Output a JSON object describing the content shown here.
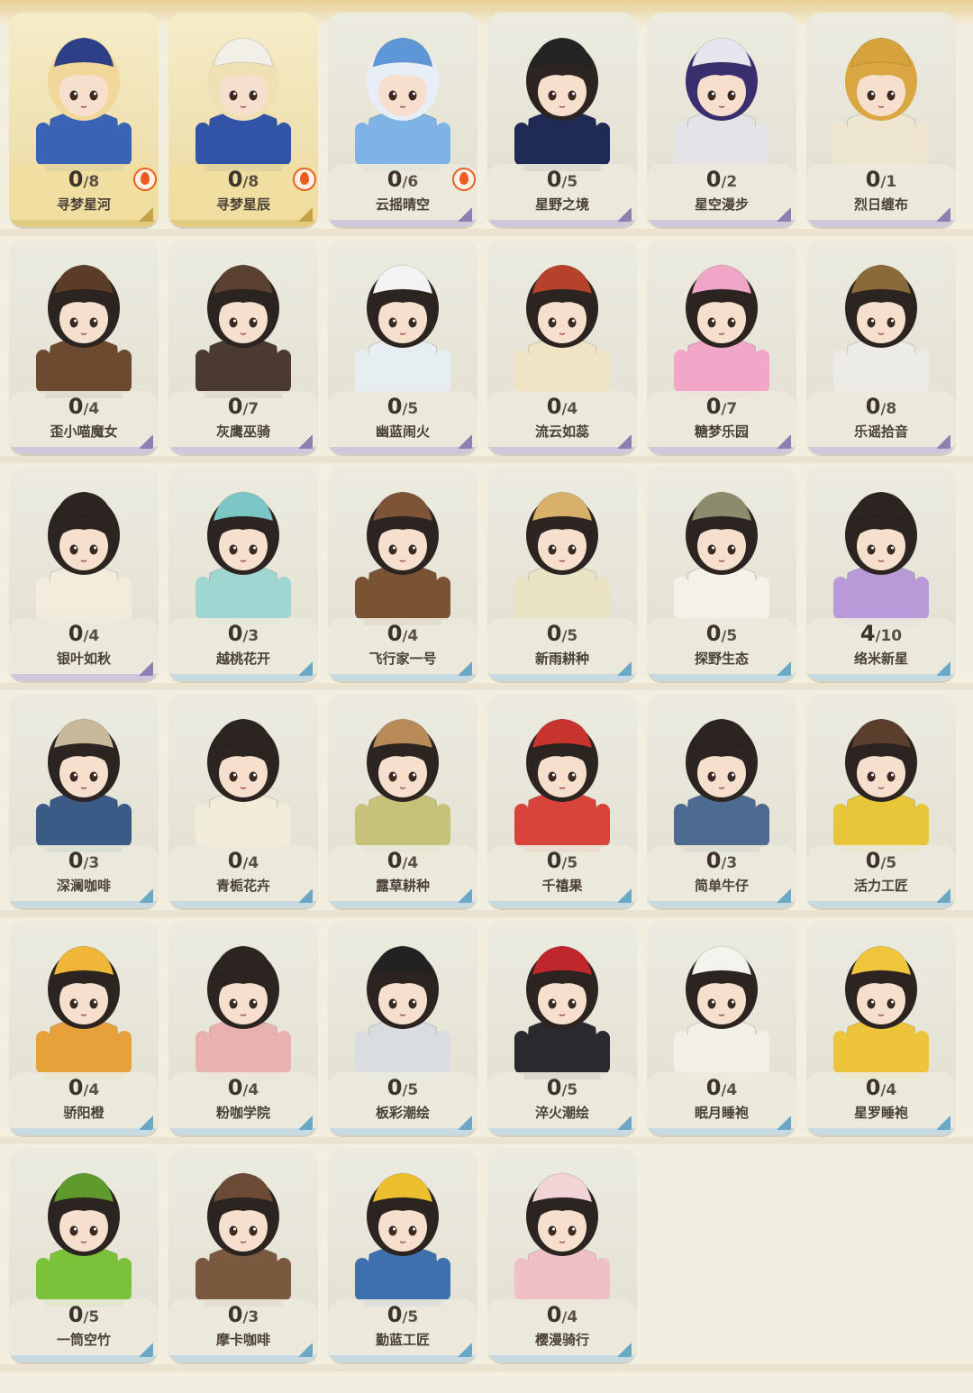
{
  "outfits": [
    {
      "name": "寻梦星河",
      "owned": "0",
      "total": "8",
      "rarity": "gold",
      "flame": true,
      "theme": {
        "hair": "#f1d79a",
        "outfit": "#3b63b5",
        "hat": "#2d3f86"
      }
    },
    {
      "name": "寻梦星辰",
      "owned": "0",
      "total": "8",
      "rarity": "gold",
      "flame": true,
      "theme": {
        "hair": "#efe0b6",
        "outfit": "#3154a6",
        "hat": "#f2efe8"
      }
    },
    {
      "name": "云摇晴空",
      "owned": "0",
      "total": "6",
      "rarity": "purple",
      "flame": true,
      "theme": {
        "hair": "#e8eef8",
        "outfit": "#7fb3e6",
        "hat": "#5d97d8"
      }
    },
    {
      "name": "星野之境",
      "owned": "0",
      "total": "5",
      "rarity": "purple",
      "flame": false,
      "theme": {
        "hair": "#2b2420",
        "outfit": "#1f2a55",
        "hat": "#232323"
      }
    },
    {
      "name": "星空漫步",
      "owned": "0",
      "total": "2",
      "rarity": "purple",
      "flame": false,
      "theme": {
        "hair": "#3a2f6e",
        "outfit": "#e3e3e8",
        "hat": "#e5e6ee"
      }
    },
    {
      "name": "烈日缠布",
      "owned": "0",
      "total": "1",
      "rarity": "purple",
      "flame": false,
      "theme": {
        "hair": "#d9a642",
        "outfit": "#efe6d2",
        "hat": "#d6a23c"
      }
    },
    {
      "name": "歪小喵魔女",
      "owned": "0",
      "total": "4",
      "rarity": "purple",
      "flame": false,
      "theme": {
        "hair": "#2b2420",
        "outfit": "#6b4a2f",
        "hat": "#5b3c26"
      }
    },
    {
      "name": "灰鹰巫骑",
      "owned": "0",
      "total": "7",
      "rarity": "purple",
      "flame": false,
      "theme": {
        "hair": "#2b2420",
        "outfit": "#4a3a30",
        "hat": "#5a4030"
      }
    },
    {
      "name": "幽蓝闹火",
      "owned": "0",
      "total": "5",
      "rarity": "purple",
      "flame": false,
      "theme": {
        "hair": "#2b2420",
        "outfit": "#e6eef2",
        "hat": "#f3f3f3"
      }
    },
    {
      "name": "流云如蕊",
      "owned": "0",
      "total": "4",
      "rarity": "purple",
      "flame": false,
      "theme": {
        "hair": "#2b2420",
        "outfit": "#efe4c4",
        "hat": "#b5432c"
      }
    },
    {
      "name": "糖梦乐园",
      "owned": "0",
      "total": "7",
      "rarity": "purple",
      "flame": false,
      "theme": {
        "hair": "#2b2420",
        "outfit": "#f3a7c8",
        "hat": "#f0a6c6"
      }
    },
    {
      "name": "乐谣拾音",
      "owned": "0",
      "total": "8",
      "rarity": "purple",
      "flame": false,
      "theme": {
        "hair": "#2b2420",
        "outfit": "#ecebe6",
        "hat": "#8a6a3a"
      }
    },
    {
      "name": "银叶如秋",
      "owned": "0",
      "total": "4",
      "rarity": "purple",
      "flame": false,
      "theme": {
        "hair": "#2b2420",
        "outfit": "#f3ecdc",
        "hat": "#2b2420"
      }
    },
    {
      "name": "越桃花开",
      "owned": "0",
      "total": "3",
      "rarity": "blue",
      "flame": false,
      "theme": {
        "hair": "#2b2420",
        "outfit": "#9fd6d2",
        "hat": "#7cc6c6"
      }
    },
    {
      "name": "飞行家一号",
      "owned": "0",
      "total": "4",
      "rarity": "blue",
      "flame": false,
      "theme": {
        "hair": "#2b2420",
        "outfit": "#7a5234",
        "hat": "#7e5436"
      }
    },
    {
      "name": "新雨耕种",
      "owned": "0",
      "total": "5",
      "rarity": "blue",
      "flame": false,
      "theme": {
        "hair": "#2b2420",
        "outfit": "#e9e3c3",
        "hat": "#d8b06a"
      }
    },
    {
      "name": "探野生态",
      "owned": "0",
      "total": "5",
      "rarity": "blue",
      "flame": false,
      "theme": {
        "hair": "#2b2420",
        "outfit": "#f3f1ea",
        "hat": "#8c8b6c"
      }
    },
    {
      "name": "络米新星",
      "owned": "4",
      "total": "10",
      "rarity": "blue",
      "flame": false,
      "theme": {
        "hair": "#2b2420",
        "outfit": "#b99ad8",
        "hat": "#2b2420"
      }
    },
    {
      "name": "深澜咖啡",
      "owned": "0",
      "total": "3",
      "rarity": "blue",
      "flame": false,
      "theme": {
        "hair": "#2b2420",
        "outfit": "#3b5a86",
        "hat": "#c9b89a"
      }
    },
    {
      "name": "青栀花卉",
      "owned": "0",
      "total": "4",
      "rarity": "blue",
      "flame": false,
      "theme": {
        "hair": "#2b2420",
        "outfit": "#f1ecd9",
        "hat": "#2b2420"
      }
    },
    {
      "name": "露草耕种",
      "owned": "0",
      "total": "4",
      "rarity": "blue",
      "flame": false,
      "theme": {
        "hair": "#2b2420",
        "outfit": "#c7c27a",
        "hat": "#b88a58"
      }
    },
    {
      "name": "千禧果",
      "owned": "0",
      "total": "5",
      "rarity": "blue",
      "flame": false,
      "theme": {
        "hair": "#2b2420",
        "outfit": "#d8433a",
        "hat": "#c9342e"
      }
    },
    {
      "name": "简单牛仔",
      "owned": "0",
      "total": "3",
      "rarity": "blue",
      "flame": false,
      "theme": {
        "hair": "#2b2420",
        "outfit": "#4d6a90",
        "hat": "#2b2420"
      }
    },
    {
      "name": "活力工匠",
      "owned": "0",
      "total": "5",
      "rarity": "blue",
      "flame": false,
      "theme": {
        "hair": "#2b2420",
        "outfit": "#e8c63a",
        "hat": "#5b3f2c"
      }
    },
    {
      "name": "骄阳橙",
      "owned": "0",
      "total": "4",
      "rarity": "blue",
      "flame": false,
      "theme": {
        "hair": "#2b2420",
        "outfit": "#e7a13b",
        "hat": "#f0b638"
      }
    },
    {
      "name": "粉咖学院",
      "owned": "0",
      "total": "4",
      "rarity": "blue",
      "flame": false,
      "theme": {
        "hair": "#2b2420",
        "outfit": "#eab1b1",
        "hat": "#2b2420"
      }
    },
    {
      "name": "板彩潮绘",
      "owned": "0",
      "total": "5",
      "rarity": "blue",
      "flame": false,
      "theme": {
        "hair": "#2b2420",
        "outfit": "#d9dde2",
        "hat": "#222222"
      }
    },
    {
      "name": "淬火潮绘",
      "owned": "0",
      "total": "5",
      "rarity": "blue",
      "flame": false,
      "theme": {
        "hair": "#2b2420",
        "outfit": "#2a2a2e",
        "hat": "#c0272d"
      }
    },
    {
      "name": "眠月睡袍",
      "owned": "0",
      "total": "4",
      "rarity": "blue",
      "flame": false,
      "theme": {
        "hair": "#2b2420",
        "outfit": "#f2efe6",
        "hat": "#f4f3ee"
      }
    },
    {
      "name": "星罗睡袍",
      "owned": "0",
      "total": "4",
      "rarity": "blue",
      "flame": false,
      "theme": {
        "hair": "#2b2420",
        "outfit": "#eec43a",
        "hat": "#efc53c"
      }
    },
    {
      "name": "一筒空竹",
      "owned": "0",
      "total": "5",
      "rarity": "blue",
      "flame": false,
      "theme": {
        "hair": "#2b2420",
        "outfit": "#7cc13a",
        "hat": "#5e9a2c"
      }
    },
    {
      "name": "摩卡咖啡",
      "owned": "0",
      "total": "3",
      "rarity": "blue",
      "flame": false,
      "theme": {
        "hair": "#2b2420",
        "outfit": "#7a5a3e",
        "hat": "#6b4a36"
      }
    },
    {
      "name": "勤蓝工匠",
      "owned": "0",
      "total": "5",
      "rarity": "blue",
      "flame": false,
      "theme": {
        "hair": "#2b2420",
        "outfit": "#3e6fae",
        "hat": "#ecbf2e"
      }
    },
    {
      "name": "樱漫骑行",
      "owned": "0",
      "total": "4",
      "rarity": "blue",
      "flame": false,
      "theme": {
        "hair": "#2b2420",
        "outfit": "#efc0c6",
        "hat": "#f2d3d6"
      }
    }
  ],
  "progress_slash": "/"
}
